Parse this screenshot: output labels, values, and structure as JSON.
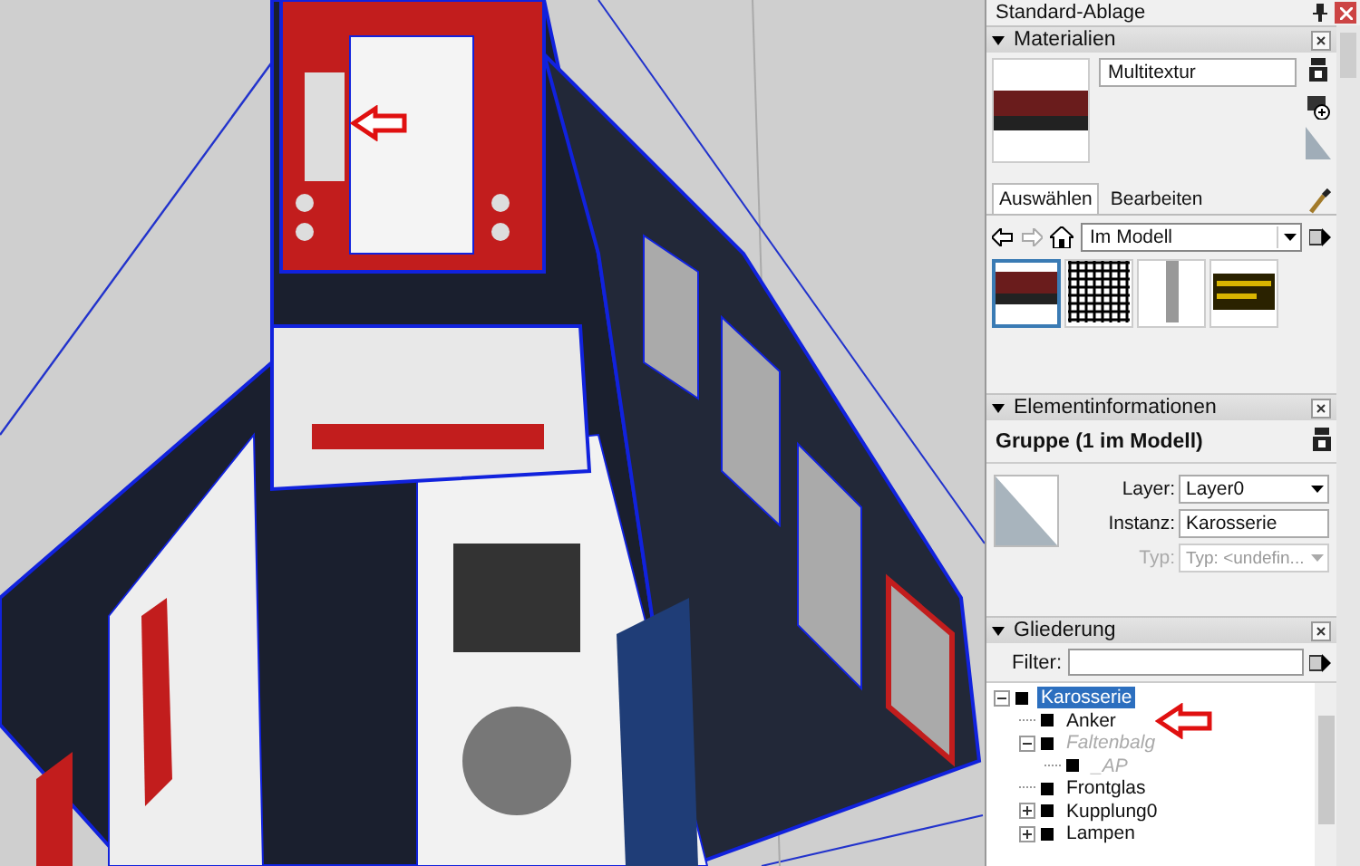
{
  "panel": {
    "title": "Standard-Ablage"
  },
  "materials": {
    "title": "Materialien",
    "name": "Multitextur",
    "tabs": [
      {
        "label": "Auswählen",
        "selected": true
      },
      {
        "label": "Bearbeiten",
        "selected": false
      }
    ],
    "collection": "Im Modell",
    "swatches": [
      {
        "kind": "photo",
        "selected": true
      },
      {
        "kind": "grid",
        "selected": false
      },
      {
        "kind": "strip",
        "selected": false
      },
      {
        "kind": "sign",
        "selected": false
      }
    ]
  },
  "entity_info": {
    "title": "Elementinformationen",
    "heading": "Gruppe (1 im Modell)",
    "fields": [
      {
        "label": "Layer:",
        "value": "Layer0",
        "kind": "dropdown",
        "disabled": false
      },
      {
        "label": "Instanz:",
        "value": "Karosserie",
        "kind": "text",
        "disabled": false
      },
      {
        "label": "Typ:",
        "value": "Typ: <undefin...",
        "kind": "dropdown",
        "disabled": true
      }
    ]
  },
  "outliner": {
    "title": "Gliederung",
    "filter_label": "Filter:",
    "tree": [
      {
        "label": "Karosserie",
        "selected": true,
        "hidden": false,
        "expanded": true,
        "children": [
          {
            "label": "Anker",
            "selected": false,
            "hidden": false
          },
          {
            "label": "Faltenbalg",
            "selected": false,
            "hidden": true,
            "expanded": true,
            "children": [
              {
                "label": "_AP",
                "selected": false,
                "hidden": true
              }
            ]
          },
          {
            "label": "Frontglas",
            "selected": false,
            "hidden": false
          },
          {
            "label": "Kupplung0",
            "selected": false,
            "hidden": false,
            "expanded": false
          },
          {
            "label": "Lampen",
            "selected": false,
            "hidden": false,
            "expanded": false
          }
        ]
      }
    ]
  }
}
